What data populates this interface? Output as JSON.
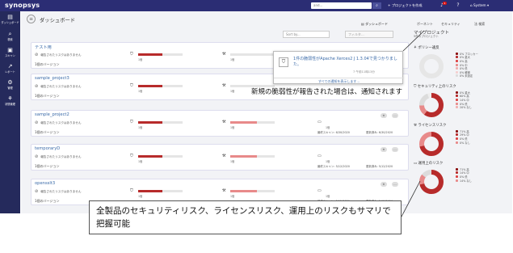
{
  "topbar": {
    "logo": "synopsys",
    "search_placeholder": "and...",
    "new_project": "+ プロジェクトを作成",
    "notification_count": "1",
    "system_menu": "System"
  },
  "sidebar": {
    "items": [
      {
        "label": "ダッシュボード",
        "icon": "dashboard-icon"
      },
      {
        "label": "検索",
        "icon": "search-icon"
      },
      {
        "label": "スキャン",
        "icon": "scan-icon"
      },
      {
        "label": "レポート",
        "icon": "report-icon"
      },
      {
        "label": "管理",
        "icon": "admin-icon"
      },
      {
        "label": "状態管理",
        "icon": "policy-icon"
      }
    ]
  },
  "header": {
    "title": "ダッシュボード",
    "sort_placeholder": "Sort by...",
    "filter_placeholder": "フィルタ...",
    "dashboard_tab": "ダッシュボード"
  },
  "right_tabs": {
    "component": "ポーネント",
    "security": "セキュリティ",
    "license": "法 検索"
  },
  "projects": [
    {
      "name": "テスト用",
      "no_risk": "報告されたリスクはありません",
      "versions": "1個のバージョン",
      "sec_count": "1個",
      "lic_count": "1個",
      "ops_count": "1個",
      "sec_fill": 0.55,
      "lic_fill": 0.0
    },
    {
      "name": "sample_project3",
      "no_risk": "報告されたリスクはありません",
      "versions": "1個のバージョン",
      "sec_count": "1個",
      "lic_count": "1個",
      "ops_count": "1個",
      "sec_fill": 0.55,
      "lic_fill": 0.0
    },
    {
      "name": "sample_project2",
      "no_risk": "報告されたリスクはありません",
      "versions": "1個のバージョン",
      "sec_count": "1個",
      "lic_count": "1個",
      "ops_count": "1個",
      "scan_time": "最終スキャン: 6/30/2020",
      "update_time": "更新済み: 6/30/2020",
      "sec_fill": 0.55,
      "lic_fill": 0.6
    },
    {
      "name": "temporaryD",
      "no_risk": "報告されたリスクはありません",
      "versions": "1個のバージョン",
      "sec_count": "1個",
      "lic_count": "1個",
      "ops_count": "1個",
      "scan_time": "最終スキャン: 5/12/2020",
      "update_time": "更新済み: 5/12/2020",
      "sec_fill": 0.55,
      "lic_fill": 0.6
    },
    {
      "name": "opensslt3",
      "no_risk": "報告されたリスクはありません",
      "versions": "1個のバージョン",
      "sec_count": "1個",
      "lic_count": "1個",
      "ops_count": "1個",
      "scan_time": "最終スキャン: 5/12/2020",
      "update_time": "更新済み: 5/12/2020",
      "sec_fill": 0.55,
      "lic_fill": 0.6
    }
  ],
  "my_projects": {
    "title": "マイプロジェクト",
    "subtitle": "5件のプロジェクト",
    "policy_title": "ポリシー違反",
    "policy_legend": [
      "0% ブロッカー",
      "0% 重大",
      "0% 高",
      "0% 中",
      "0% 低",
      "0% 軽微",
      "0% 未設定"
    ],
    "security_title": "セキュリティ上のリスク",
    "security_legend": [
      "0% 重大",
      "60% 高",
      "14% 中",
      "0% 低",
      "20% なし"
    ],
    "license_title": "ライセンスリスク",
    "license_legend": [
      "71% 高",
      "29% 中",
      "0% 低",
      "0% なし"
    ],
    "ops_title": "運用上のリスク",
    "ops_legend": [
      "71% 高",
      "14% 中",
      "0% 低",
      "14% なし"
    ]
  },
  "notification": {
    "text": "1件の脆弱性がApache Xerces2 J 1.3.04で見つかりました。",
    "time": "7 午前11時13分",
    "see_all": "すべての通知を表示します..."
  },
  "callouts": {
    "note1": "新規の脆弱性が報告された場合は、通知されます",
    "note2": "全製品のセキュリティリスク、ライセンスリスク、運用上のリスクもサマリで把握可能"
  },
  "colors": {
    "topbar": "#2b2d74",
    "sidebar": "#252a5c",
    "risk_high": "#b72b2b",
    "risk_medium": "#e88a8a",
    "link": "#3a6aa8"
  },
  "donuts": {
    "security": [
      {
        "pct": 60,
        "color": "#b72b2b"
      },
      {
        "pct": 14,
        "color": "#e88a8a"
      },
      {
        "pct": 20,
        "color": "#dcdcdc"
      }
    ],
    "license": [
      {
        "pct": 71,
        "color": "#b72b2b"
      },
      {
        "pct": 29,
        "color": "#e88a8a"
      }
    ],
    "ops": [
      {
        "pct": 71,
        "color": "#b72b2b"
      },
      {
        "pct": 14,
        "color": "#e88a8a"
      },
      {
        "pct": 14,
        "color": "#dcdcdc"
      }
    ]
  }
}
